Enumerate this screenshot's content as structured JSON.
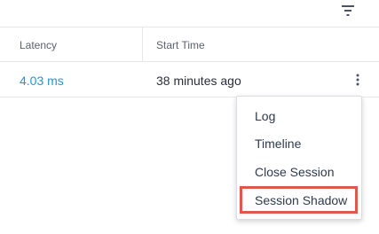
{
  "toolbar": {
    "filter_icon": "filter-icon"
  },
  "table": {
    "columns": [
      "Latency",
      "Start Time"
    ],
    "rows": [
      {
        "latency": "4.03 ms",
        "start_time": "38 minutes ago"
      }
    ],
    "row_menu_icon": "kebab-vertical-icon"
  },
  "context_menu": {
    "items": [
      "Log",
      "Timeline",
      "Close Session",
      "Session Shadow"
    ],
    "highlighted_item": "Session Shadow"
  },
  "colors": {
    "link": "#2196d3",
    "highlight": "#e2574c",
    "text": "#2a2e38",
    "header_text": "#5a6070"
  }
}
